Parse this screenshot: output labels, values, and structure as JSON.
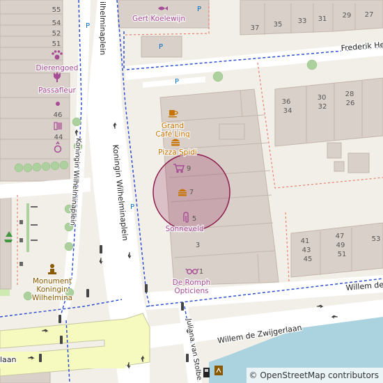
{
  "streets": {
    "wilhelminaplein_top": "ilhelminaplein",
    "koningin_wilhelminaplein_main": "Koningin Wilhelminaplein",
    "koningin_wilhelminaplein_left": "Koningin Wilhelminaplein",
    "frederik": "Frederik He",
    "willem_de": "Willem de",
    "willem_de_zwijgerlaan": "Willem de Zwijgerlaan",
    "juliana_van_stolberg": "Juliana van Stolbe",
    "laan_left": "laan"
  },
  "pois": {
    "gert_koelewijn": "Gert Koelewijn",
    "dierengoed": "Dierengoed",
    "passafleur": "Passafleur",
    "grand_cafe_line1": "Grand",
    "grand_cafe_line2": "Café Linq",
    "pizza_spidi": "Pizza Spidi",
    "sonneveld": "Sonneveld",
    "de_romph_line1": "De Romph",
    "de_romph_line2": "Opticiens",
    "monument_line1": "Monument",
    "monument_line2": "Koningin",
    "monument_line3": "Wilhelmina"
  },
  "house_numbers": {
    "n55": "55",
    "n54": "54",
    "n52": "52",
    "n51": "51",
    "n46": "46",
    "n44": "44",
    "n37": "37",
    "n35": "35",
    "n33": "33",
    "n31": "31",
    "n29": "29",
    "n27": "27",
    "n36_34": "36\n34",
    "n30_32": "30\n32",
    "n28_26": "28\n26",
    "n9": "9",
    "n7": "7",
    "n5": "5",
    "n3": "3",
    "n1": "1",
    "n41_43_45": "41\n43\n45",
    "n47_49_51": "47\n49\n51",
    "n53": "53"
  },
  "parking_label": "P",
  "attribution": "© OpenStreetMap contributors",
  "colors": {
    "background": "#f2efe9",
    "building": "#d9d0c9",
    "building_outline": "#c4b6ab",
    "road": "#ffffff",
    "secondary_road": "#f7fabf",
    "footway_blue": "#2d4fd0",
    "boundary_red": "#e8806c",
    "poi_label": "#a64b96",
    "food_label": "#c77400",
    "street_label": "#222222",
    "parking_label": "#0070c0",
    "water": "#aad3df",
    "tree_green": "#add19e",
    "highlight_circle": "#8c1a4d"
  }
}
